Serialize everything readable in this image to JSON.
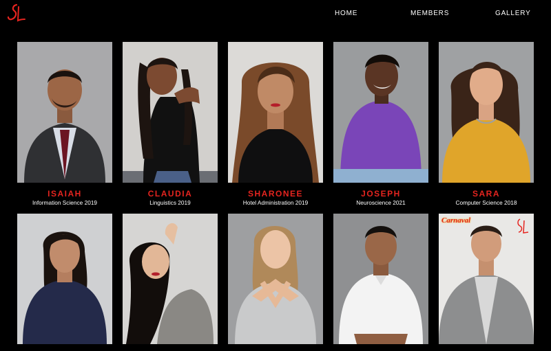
{
  "nav": {
    "home": "HOME",
    "members": "MEMBERS",
    "gallery": "GALLERY"
  },
  "accent_color": "#e5241f",
  "members_row1": [
    {
      "name": "ISAIAH",
      "major": "Information Science 2019"
    },
    {
      "name": "CLAUDIA",
      "major": "Linguistics 2019"
    },
    {
      "name": "SHARONEE",
      "major": "Hotel Administration 2019"
    },
    {
      "name": "JOSEPH",
      "major": "Neuroscience 2021"
    },
    {
      "name": "SARA",
      "major": "Computer Science 2018"
    }
  ],
  "photo5_badge": "Carnaval"
}
